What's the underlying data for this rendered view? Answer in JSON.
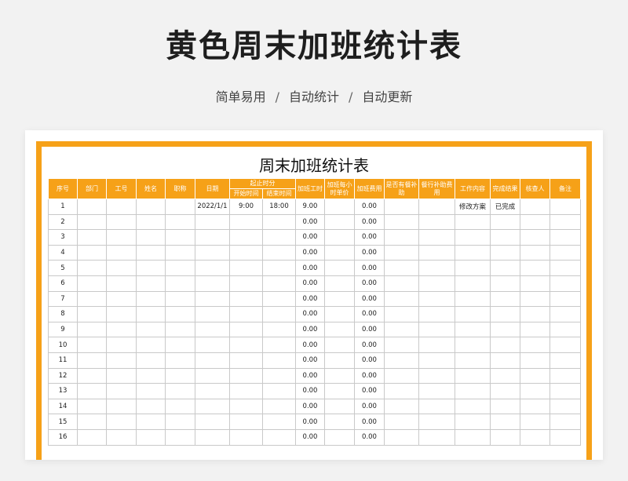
{
  "page": {
    "title": "黄色周末加班统计表",
    "subtitle": [
      "简单易用",
      "自动统计",
      "自动更新"
    ],
    "separator": "/"
  },
  "colors": {
    "accent": "#f6a118",
    "header_text": "#ffffff"
  },
  "sheet": {
    "title": "周末加班统计表",
    "headers": {
      "seq": "序号",
      "dept": "部门",
      "id": "工号",
      "name": "姓名",
      "position": "职称",
      "date": "日期",
      "time_range": "起止时分",
      "start": "开始时间",
      "end": "结束时间",
      "hours": "加班工时",
      "hourly": "加班每小时单价",
      "fee": "加班费用",
      "injury": "是否有餐补助",
      "meal": "餐行补助费用",
      "work": "工作内容",
      "result": "完成结果",
      "approver": "核查人",
      "notes": "备注"
    },
    "rows": [
      {
        "seq": "1",
        "dept": "",
        "id": "",
        "name": "",
        "position": "",
        "date": "2022/1/1",
        "start": "9:00",
        "end": "18:00",
        "hours": "9.00",
        "hourly": "",
        "fee": "0.00",
        "injury": "",
        "meal": "",
        "work": "修改方案",
        "result": "已完成",
        "approver": "",
        "notes": ""
      },
      {
        "seq": "2",
        "dept": "",
        "id": "",
        "name": "",
        "position": "",
        "date": "",
        "start": "",
        "end": "",
        "hours": "0.00",
        "hourly": "",
        "fee": "0.00",
        "injury": "",
        "meal": "",
        "work": "",
        "result": "",
        "approver": "",
        "notes": ""
      },
      {
        "seq": "3",
        "dept": "",
        "id": "",
        "name": "",
        "position": "",
        "date": "",
        "start": "",
        "end": "",
        "hours": "0.00",
        "hourly": "",
        "fee": "0.00",
        "injury": "",
        "meal": "",
        "work": "",
        "result": "",
        "approver": "",
        "notes": ""
      },
      {
        "seq": "4",
        "dept": "",
        "id": "",
        "name": "",
        "position": "",
        "date": "",
        "start": "",
        "end": "",
        "hours": "0.00",
        "hourly": "",
        "fee": "0.00",
        "injury": "",
        "meal": "",
        "work": "",
        "result": "",
        "approver": "",
        "notes": ""
      },
      {
        "seq": "5",
        "dept": "",
        "id": "",
        "name": "",
        "position": "",
        "date": "",
        "start": "",
        "end": "",
        "hours": "0.00",
        "hourly": "",
        "fee": "0.00",
        "injury": "",
        "meal": "",
        "work": "",
        "result": "",
        "approver": "",
        "notes": ""
      },
      {
        "seq": "6",
        "dept": "",
        "id": "",
        "name": "",
        "position": "",
        "date": "",
        "start": "",
        "end": "",
        "hours": "0.00",
        "hourly": "",
        "fee": "0.00",
        "injury": "",
        "meal": "",
        "work": "",
        "result": "",
        "approver": "",
        "notes": ""
      },
      {
        "seq": "7",
        "dept": "",
        "id": "",
        "name": "",
        "position": "",
        "date": "",
        "start": "",
        "end": "",
        "hours": "0.00",
        "hourly": "",
        "fee": "0.00",
        "injury": "",
        "meal": "",
        "work": "",
        "result": "",
        "approver": "",
        "notes": ""
      },
      {
        "seq": "8",
        "dept": "",
        "id": "",
        "name": "",
        "position": "",
        "date": "",
        "start": "",
        "end": "",
        "hours": "0.00",
        "hourly": "",
        "fee": "0.00",
        "injury": "",
        "meal": "",
        "work": "",
        "result": "",
        "approver": "",
        "notes": ""
      },
      {
        "seq": "9",
        "dept": "",
        "id": "",
        "name": "",
        "position": "",
        "date": "",
        "start": "",
        "end": "",
        "hours": "0.00",
        "hourly": "",
        "fee": "0.00",
        "injury": "",
        "meal": "",
        "work": "",
        "result": "",
        "approver": "",
        "notes": ""
      },
      {
        "seq": "10",
        "dept": "",
        "id": "",
        "name": "",
        "position": "",
        "date": "",
        "start": "",
        "end": "",
        "hours": "0.00",
        "hourly": "",
        "fee": "0.00",
        "injury": "",
        "meal": "",
        "work": "",
        "result": "",
        "approver": "",
        "notes": ""
      },
      {
        "seq": "11",
        "dept": "",
        "id": "",
        "name": "",
        "position": "",
        "date": "",
        "start": "",
        "end": "",
        "hours": "0.00",
        "hourly": "",
        "fee": "0.00",
        "injury": "",
        "meal": "",
        "work": "",
        "result": "",
        "approver": "",
        "notes": ""
      },
      {
        "seq": "12",
        "dept": "",
        "id": "",
        "name": "",
        "position": "",
        "date": "",
        "start": "",
        "end": "",
        "hours": "0.00",
        "hourly": "",
        "fee": "0.00",
        "injury": "",
        "meal": "",
        "work": "",
        "result": "",
        "approver": "",
        "notes": ""
      },
      {
        "seq": "13",
        "dept": "",
        "id": "",
        "name": "",
        "position": "",
        "date": "",
        "start": "",
        "end": "",
        "hours": "0.00",
        "hourly": "",
        "fee": "0.00",
        "injury": "",
        "meal": "",
        "work": "",
        "result": "",
        "approver": "",
        "notes": ""
      },
      {
        "seq": "14",
        "dept": "",
        "id": "",
        "name": "",
        "position": "",
        "date": "",
        "start": "",
        "end": "",
        "hours": "0.00",
        "hourly": "",
        "fee": "0.00",
        "injury": "",
        "meal": "",
        "work": "",
        "result": "",
        "approver": "",
        "notes": ""
      },
      {
        "seq": "15",
        "dept": "",
        "id": "",
        "name": "",
        "position": "",
        "date": "",
        "start": "",
        "end": "",
        "hours": "0.00",
        "hourly": "",
        "fee": "0.00",
        "injury": "",
        "meal": "",
        "work": "",
        "result": "",
        "approver": "",
        "notes": ""
      },
      {
        "seq": "16",
        "dept": "",
        "id": "",
        "name": "",
        "position": "",
        "date": "",
        "start": "",
        "end": "",
        "hours": "0.00",
        "hourly": "",
        "fee": "0.00",
        "injury": "",
        "meal": "",
        "work": "",
        "result": "",
        "approver": "",
        "notes": ""
      }
    ]
  }
}
